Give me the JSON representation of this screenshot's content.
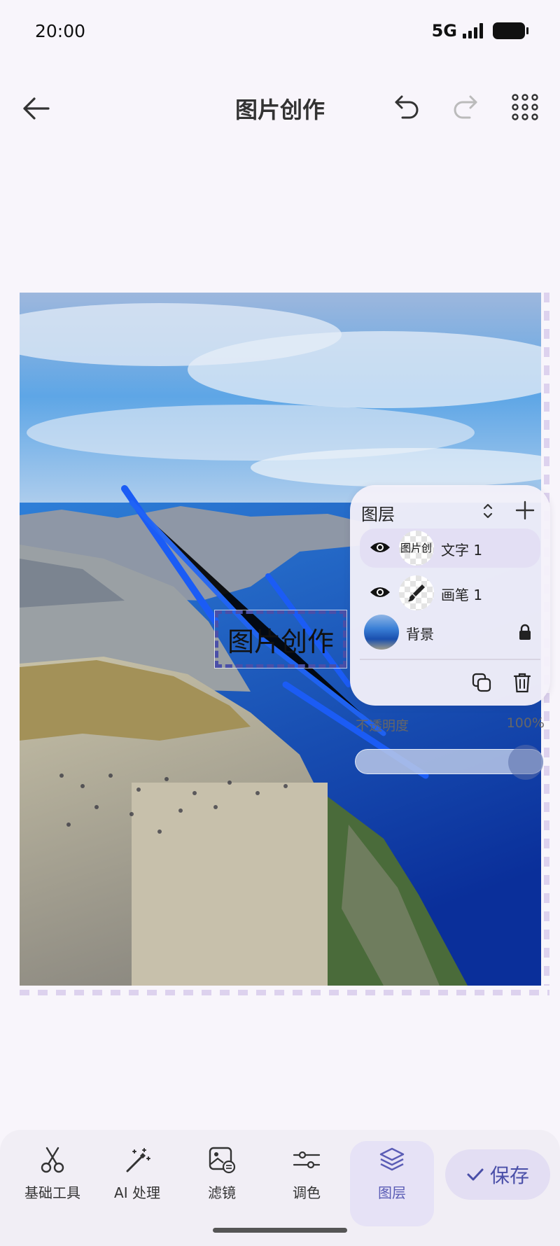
{
  "status_bar": {
    "time": "20:00",
    "network": "5G"
  },
  "app_bar": {
    "title": "图片创作"
  },
  "canvas": {
    "text_layer_content": "图片创作"
  },
  "layers_panel": {
    "title": "图层",
    "layers": [
      {
        "thumb_text": "图片创",
        "name": "文字 1",
        "selected": true
      },
      {
        "name": "画笔 1",
        "selected": false
      },
      {
        "name": "背景",
        "locked": true
      }
    ],
    "opacity_label": "不透明度",
    "opacity_value": "100%",
    "opacity_level": 1.0
  },
  "toolbar": {
    "tools": [
      {
        "label": "基础工具",
        "icon": "scissors-icon"
      },
      {
        "label": "AI 处理",
        "icon": "magic-wand-icon"
      },
      {
        "label": "滤镜",
        "icon": "filter-icon"
      },
      {
        "label": "调色",
        "icon": "sliders-icon"
      },
      {
        "label": "图层",
        "icon": "layers-icon",
        "active": true
      }
    ],
    "save_label": "保存"
  },
  "colors": {
    "accent": "#4a4fa8",
    "background": "#f8f5fb",
    "active_tab": "#e6e2f6"
  }
}
